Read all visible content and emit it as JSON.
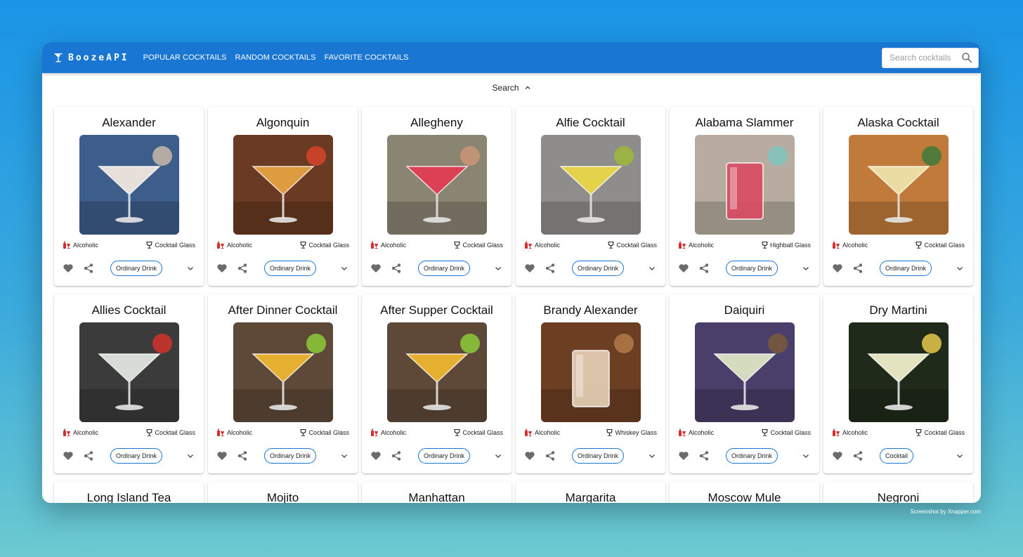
{
  "app": {
    "brand": "BoozeAPI",
    "nav": [
      "POPULAR COCKTAILS",
      "RANDOM COCKTAILS",
      "FAVORITE COCKTAILS"
    ],
    "search_placeholder": "Search cocktails",
    "accent_color": "#1976d2"
  },
  "search_toggle": {
    "label": "Search"
  },
  "cards": [
    {
      "title": "Alexander",
      "alcoholic": "Alcoholic",
      "glass": "Cocktail Glass",
      "category": "Ordinary Drink",
      "scene": [
        "#3d5d8a",
        "#efe6de",
        "#c9b8a8"
      ]
    },
    {
      "title": "Algonquin",
      "alcoholic": "Alcoholic",
      "glass": "Cocktail Glass",
      "category": "Ordinary Drink",
      "scene": [
        "#6a3a22",
        "#e6a042",
        "#d6452a"
      ]
    },
    {
      "title": "Allegheny",
      "alcoholic": "Alcoholic",
      "glass": "Cocktail Glass",
      "category": "Ordinary Drink",
      "scene": [
        "#8a8472",
        "#e03c52",
        "#c99576"
      ]
    },
    {
      "title": "Alfie Cocktail",
      "alcoholic": "Alcoholic",
      "glass": "Cocktail Glass",
      "category": "Ordinary Drink",
      "scene": [
        "#8f8d8b",
        "#e9d64a",
        "#9fb83a"
      ]
    },
    {
      "title": "Alabama Slammer",
      "alcoholic": "Alcoholic",
      "glass": "Highball Glass",
      "category": "Ordinary Drink",
      "scene": [
        "#b8aca0",
        "#d84a62",
        "#7fc4bd"
      ]
    },
    {
      "title": "Alaska Cocktail",
      "alcoholic": "Alcoholic",
      "glass": "Cocktail Glass",
      "category": "Ordinary Drink",
      "scene": [
        "#c07a3a",
        "#ede3a6",
        "#3d7a3c"
      ]
    },
    {
      "title": "Allies Cocktail",
      "alcoholic": "Alcoholic",
      "glass": "Cocktail Glass",
      "category": "Ordinary Drink",
      "scene": [
        "#3b3b3b",
        "#dfe6de",
        "#d2332a"
      ]
    },
    {
      "title": "After Dinner Cocktail",
      "alcoholic": "Alcoholic",
      "glass": "Cocktail Glass",
      "category": "Ordinary Drink",
      "scene": [
        "#5e4838",
        "#ecb52e",
        "#8ccc3a"
      ]
    },
    {
      "title": "After Supper Cocktail",
      "alcoholic": "Alcoholic",
      "glass": "Cocktail Glass",
      "category": "Ordinary Drink",
      "scene": [
        "#5e4838",
        "#ecb52e",
        "#8ccc3a"
      ]
    },
    {
      "title": "Brandy Alexander",
      "alcoholic": "Alcoholic",
      "glass": "Whiskey Glass",
      "category": "Ordinary Drink",
      "scene": [
        "#6d3f22",
        "#e6d2b8",
        "#b37a4a"
      ]
    },
    {
      "title": "Daiquiri",
      "alcoholic": "Alcoholic",
      "glass": "Cocktail Glass",
      "category": "Ordinary Drink",
      "scene": [
        "#4a3e6a",
        "#dbe4c4",
        "#7a5a3a"
      ]
    },
    {
      "title": "Dry Martini",
      "alcoholic": "Alcoholic",
      "glass": "Cocktail Glass",
      "category": "Cocktail",
      "scene": [
        "#1f2a1a",
        "#eeeec8",
        "#e8c84a"
      ]
    }
  ],
  "next_row_titles": [
    "Long Island Tea",
    "Mojito",
    "Manhattan",
    "Margarita",
    "Moscow Mule",
    "Negroni"
  ],
  "watermark": "Screenshot by Xnapper.com"
}
